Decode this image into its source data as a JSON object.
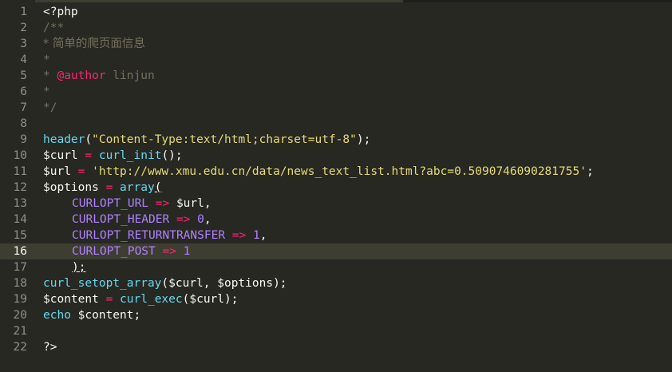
{
  "colors": {
    "background": "#272822",
    "text": "#f8f8f2",
    "keyword_fn": "#66d9ef",
    "operator": "#f92672",
    "string": "#e6db74",
    "constant": "#ae81ff",
    "comment": "#75715e",
    "current_line": "#3e3d32"
  },
  "gutter": {
    "line_numbers": [
      "1",
      "2",
      "3",
      "4",
      "5",
      "6",
      "7",
      "8",
      "9",
      "10",
      "11",
      "12",
      "13",
      "14",
      "15",
      "16",
      "17",
      "18",
      "19",
      "20",
      "21",
      "22"
    ],
    "current_line": "16"
  },
  "code": {
    "l1": {
      "text": "<?php"
    },
    "l2": {
      "text": "/**"
    },
    "l3": {
      "text": "* 简单的爬页面信息"
    },
    "l4": {
      "text": "*"
    },
    "l5": {
      "star": "* ",
      "tag": "@author",
      "rest": " linjun"
    },
    "l6": {
      "text": "*"
    },
    "l7": {
      "text": "*/"
    },
    "l9": {
      "fn": "header",
      "p1": "(",
      "str": "\"Content-Type:text/html;charset=utf-8\"",
      "p2": ");"
    },
    "l10": {
      "var": "$curl",
      "op": " = ",
      "fn": "curl_init",
      "rest": "();"
    },
    "l11": {
      "var": "$url",
      "op": " = ",
      "str": "'http://www.xmu.edu.cn/data/news_text_list.html?abc=0.5090746090281755'",
      "rest": ";"
    },
    "l12": {
      "var": "$options",
      "op": " = ",
      "fn": "array",
      "rest": "("
    },
    "l13": {
      "const": "CURLOPT_URL",
      "arrow": " => ",
      "val": "$url",
      "rest": ","
    },
    "l14": {
      "const": "CURLOPT_HEADER",
      "arrow": " => ",
      "num": "0",
      "rest": ","
    },
    "l15": {
      "const": "CURLOPT_RETURNTRANSFER",
      "arrow": " => ",
      "num": "1",
      "rest": ","
    },
    "l16": {
      "const": "CURLOPT_POST",
      "arrow": " => ",
      "num": "1"
    },
    "l17": {
      "text": ");"
    },
    "l18": {
      "fn": "curl_setopt_array",
      "rest": "($curl, $options);"
    },
    "l19": {
      "var": "$content",
      "op": " = ",
      "fn": "curl_exec",
      "rest": "($curl);"
    },
    "l20": {
      "fn": "echo",
      "rest": " $content;"
    },
    "l22": {
      "text": "?>"
    }
  }
}
